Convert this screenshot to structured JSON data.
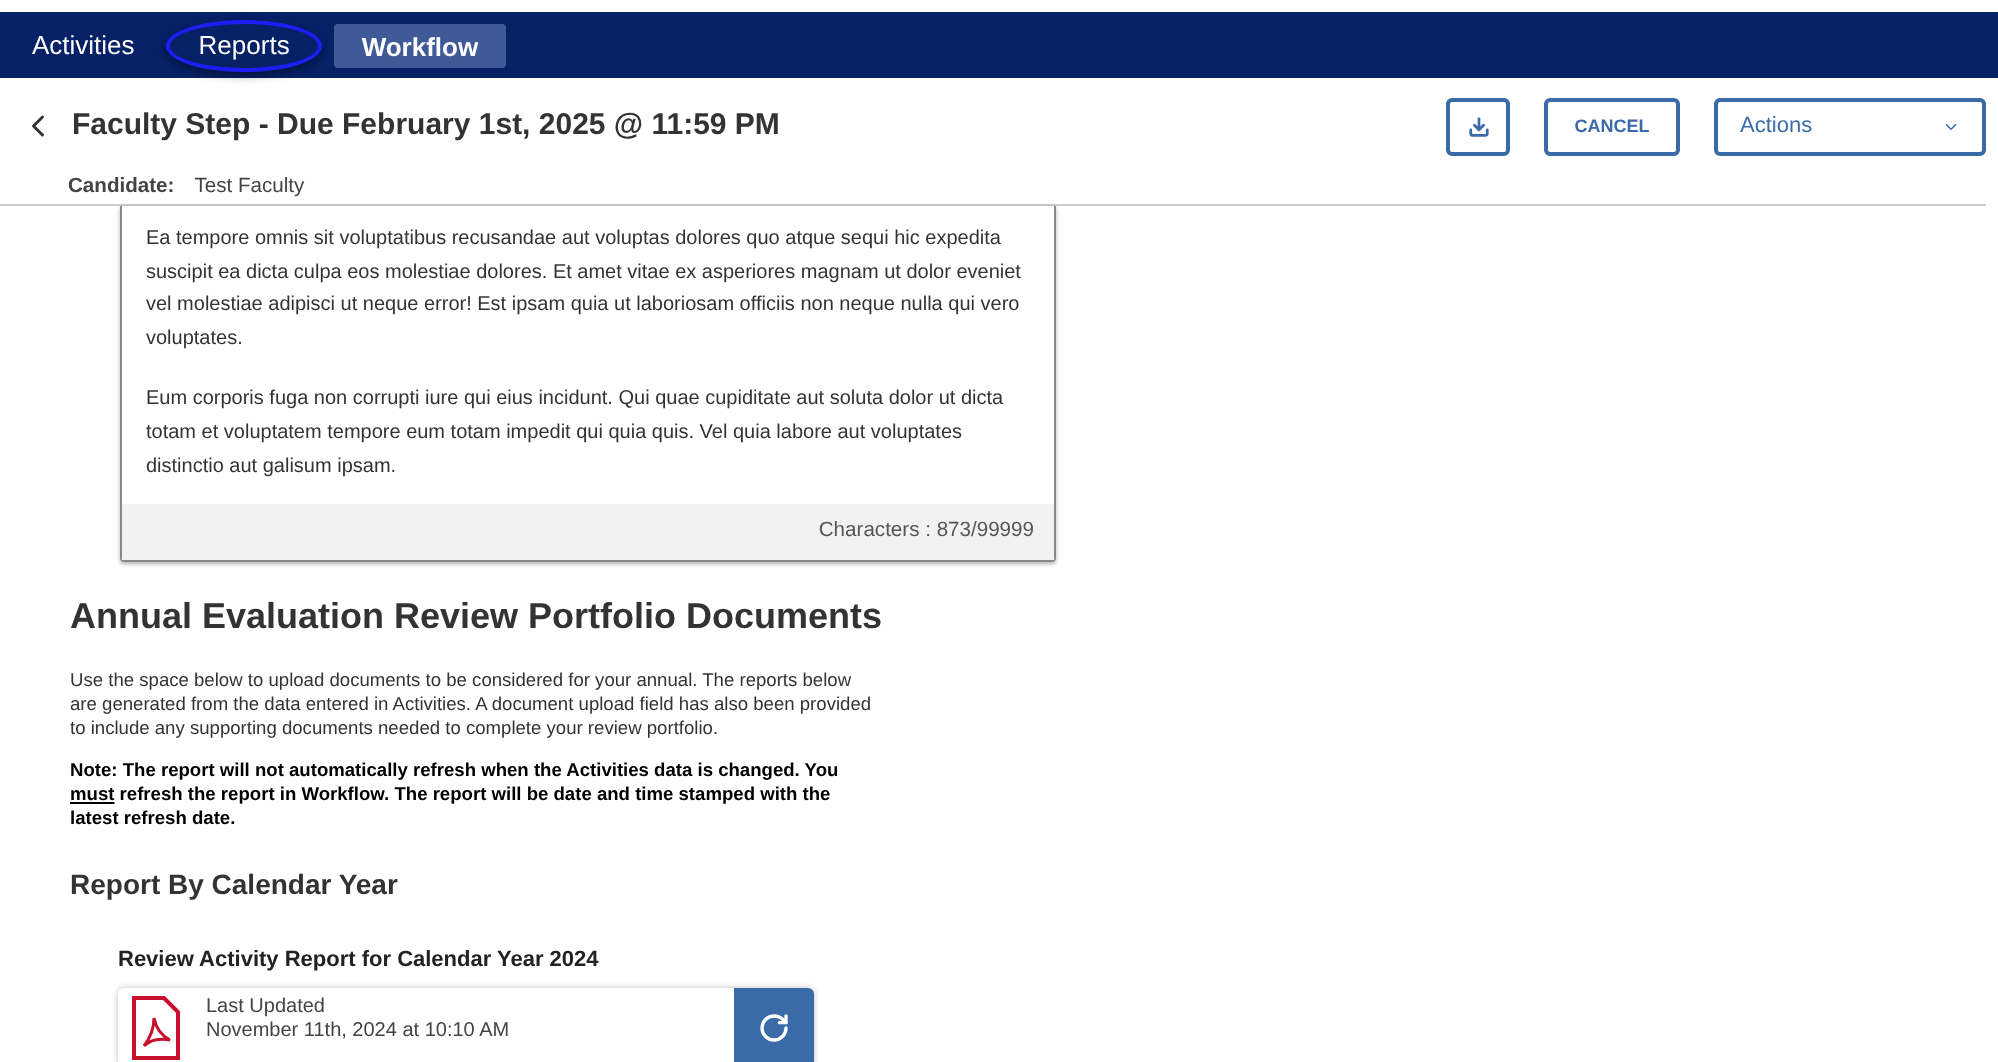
{
  "nav": {
    "tabs": [
      {
        "label": "Activities",
        "selected": false,
        "circled": false
      },
      {
        "label": "Reports",
        "selected": false,
        "circled": true
      },
      {
        "label": "Workflow",
        "selected": true,
        "circled": false
      }
    ]
  },
  "header": {
    "title": "Faculty Step - Due February 1st, 2025 @ 11:59 PM",
    "candidate_label": "Candidate:",
    "candidate": "Test Faculty",
    "cancel": "CANCEL",
    "actions": "Actions"
  },
  "editor": {
    "paragraphs": [
      "Ea tempore omnis sit voluptatibus recusandae aut voluptas dolores quo atque sequi hic expedita suscipit ea dicta culpa eos molestiae dolores. Et amet vitae ex asperiores magnam ut dolor eveniet vel molestiae adipisci ut neque error! Est ipsam quia ut laboriosam officiis non neque nulla qui vero voluptates.",
      "Eum corporis fuga non corrupti iure qui eius incidunt. Qui quae cupiditate aut soluta dolor ut dicta totam et voluptatem tempore eum totam impedit qui quia quis. Vel quia labore aut voluptates distinctio aut galisum ipsam."
    ],
    "counter": "Characters : 873/99999"
  },
  "section": {
    "title": "Annual Evaluation Review Portfolio Documents",
    "intro": "Use the space below to upload documents to be considered for your annual. The reports below are generated from the data entered in Activities. A document upload field has also been provided to include any supporting documents needed to complete your review portfolio.",
    "note": [
      {
        "text": "Note:  The report will not automatically refresh when the Activities data is changed. You ",
        "underline": false
      },
      {
        "text": "must",
        "underline": true
      },
      {
        "text": " refresh the report in Workflow. The report will be date and time stamped with the latest refresh date.",
        "underline": false
      }
    ],
    "subtitle": "Report By Calendar Year",
    "report": {
      "title": "Review Activity Report for Calendar Year 2024",
      "updated_label": "Last Updated",
      "updated": "November 11th, 2024 at 10:10 AM"
    }
  }
}
